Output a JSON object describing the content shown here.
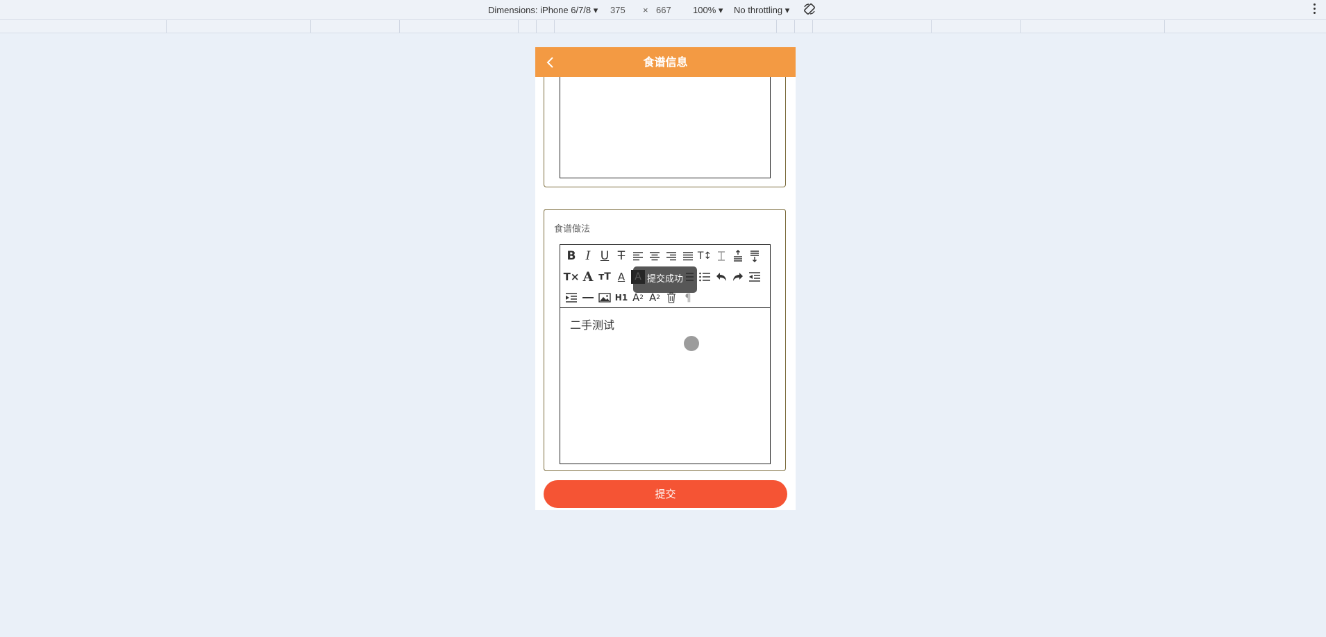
{
  "devtools": {
    "dimensions_label": "Dimensions: iPhone 6/7/8 ▾",
    "width": "375",
    "times": "×",
    "height": "667",
    "zoom": "100% ▾",
    "throttling": "No throttling ▾"
  },
  "nav": {
    "title": "食谱信息"
  },
  "method_section": {
    "label": "食谱做法",
    "content": "二手测试"
  },
  "toast": {
    "text": "提交成功"
  },
  "submit": {
    "label": "提交"
  },
  "colors": {
    "nav_bg": "#f39a43",
    "submit_bg": "#f55434",
    "page_bg": "#eaf0f8"
  },
  "toolbar_icons": [
    "bold-icon",
    "italic-icon",
    "underline-icon",
    "strikethrough-icon",
    "align-left-icon",
    "align-center-icon",
    "align-right-icon",
    "align-justify-icon",
    "font-size-icon",
    "line-height-icon",
    "space-before-icon",
    "space-after-icon",
    "clear-format-icon",
    "font-family-icon",
    "text-size-icon",
    "font-color-icon",
    "background-color-icon",
    "ordered-list-icon",
    "unordered-list-icon",
    "undo-icon",
    "redo-icon",
    "outdent-icon",
    "indent-icon",
    "horizontal-rule-icon",
    "image-icon",
    "heading-icon",
    "subscript-icon",
    "superscript-icon",
    "delete-icon",
    "paragraph-icon"
  ]
}
